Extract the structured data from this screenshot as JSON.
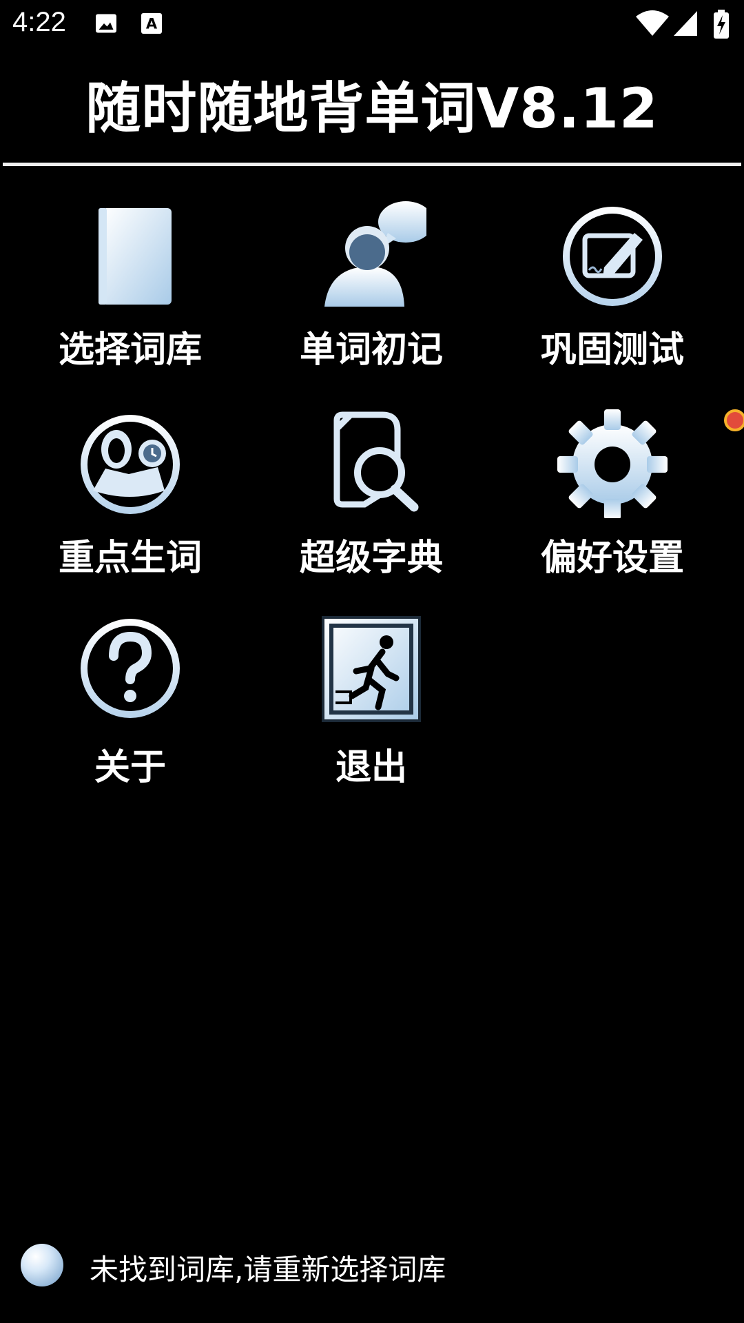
{
  "status_bar": {
    "time": "4:22",
    "icons": [
      "image-icon",
      "a-keyboard-icon",
      "wifi-icon",
      "signal-icon",
      "battery-charging-icon"
    ]
  },
  "header": {
    "title": "随时随地背单词V8.12"
  },
  "menu": {
    "items": [
      {
        "label": "选择词库",
        "icon": "book-icon"
      },
      {
        "label": "单词初记",
        "icon": "person-speech-icon"
      },
      {
        "label": "巩固测试",
        "icon": "edit-test-icon"
      },
      {
        "label": "重点生词",
        "icon": "user-clock-icon"
      },
      {
        "label": "超级字典",
        "icon": "document-search-icon"
      },
      {
        "label": "偏好设置",
        "icon": "gear-icon"
      },
      {
        "label": "关于",
        "icon": "question-icon"
      },
      {
        "label": "退出",
        "icon": "exit-icon"
      }
    ]
  },
  "footer": {
    "message": "未找到词库,请重新选择词库"
  },
  "colors": {
    "background": "#000000",
    "icon_light": "#e6f1fb",
    "icon_mid": "#bcd6ee",
    "badge": "#e24b3b"
  }
}
